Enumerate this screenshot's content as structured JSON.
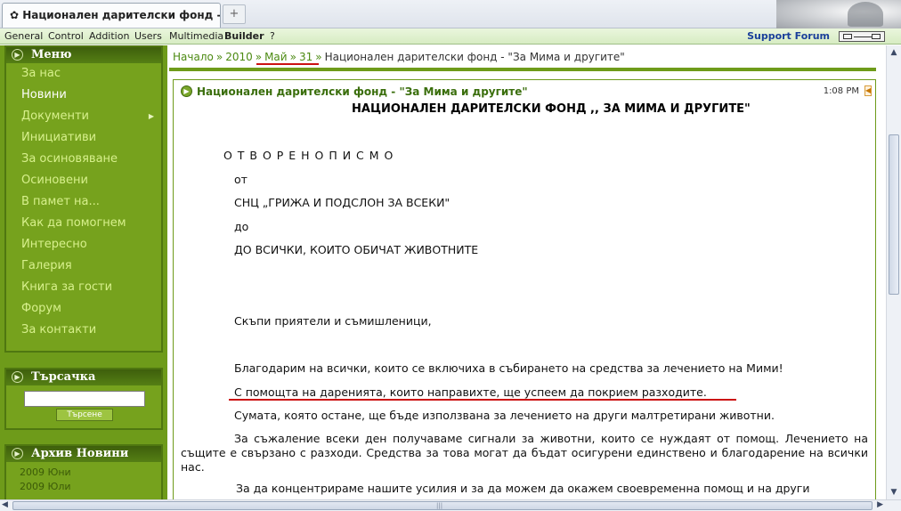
{
  "browser": {
    "tab_title": "Национален дарителски фонд - \"З...",
    "new_tab_symbol": "+",
    "favicon": "paw-icon"
  },
  "menubar": {
    "items": [
      "General",
      "Control",
      "Addition",
      "Users",
      "Multimedia",
      "Builder",
      "?"
    ],
    "support": "Support Forum"
  },
  "sidebar": {
    "menu_title": "Меню",
    "menu_items": [
      "За нас",
      "Новини",
      "Документи",
      "Инициативи",
      "За осиновяване",
      "Осиновени",
      "В памет на...",
      "Как да помогнем",
      "Интересно",
      "Галерия",
      "Книга за гости",
      "Форум",
      "За контакти"
    ],
    "search_title": "Търсачка",
    "search_button": "Търсене",
    "archive_title": "Архив Новини",
    "archive_items": [
      "2009 Юни",
      "2009 Юли"
    ]
  },
  "breadcrumb": {
    "home": "Начало",
    "year": "2010",
    "month": "Май",
    "day": "31",
    "current": "Национален дарителски фонд - \"За Мима и другите\"",
    "separator": "»"
  },
  "article": {
    "title": "Национален дарителски фонд - \"За Мима и другите\"",
    "time": "1:08 PM",
    "heading": "НАЦИОНАЛЕН ДАРИТЕЛСКИ ФОНД ,, ЗА МИМА И ДРУГИТЕ\"",
    "letter_title": "О Т В О Р Е Н О   П И С М О",
    "from_label": "от",
    "from_org": "СНЦ „ГРИЖА И ПОДСЛОН ЗА ВСЕКИ\"",
    "to_label": "до",
    "to_who": "ДО ВСИЧКИ, КОИТО ОБИЧАТ ЖИВОТНИТЕ",
    "greeting": "Скъпи приятели и съмишленици,",
    "p1": "Благодарим на всички, които се включиха в събирането на средства за лечението на Мими!",
    "p2": "С помощта на даренията, които направихте, ще успеем да покрием разходите.",
    "p3": "Сумата, която остане, ще бъде използвана за лечението на други малтретирани животни.",
    "p4": "За съжаление всеки ден получаваме сигнали за животни, които се нуждаят от помощ. Лечението на същите е свързано с разходи. Средства за това могат да бъдат осигурени единствено и  благодарение на всички нас.",
    "p5": "За да концентрираме нашите усилия и за да можем да окажем своевременна помощ и на други"
  }
}
